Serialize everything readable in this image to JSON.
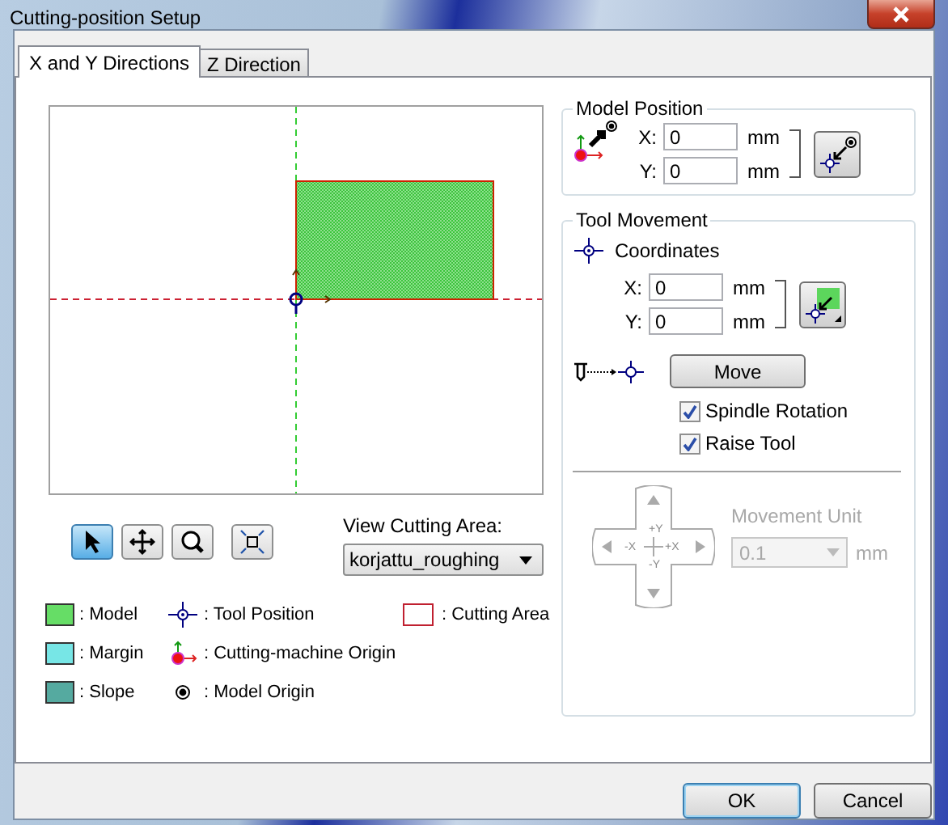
{
  "window": {
    "title": "Cutting-position Setup"
  },
  "tabs": [
    {
      "label": "X and Y Directions",
      "selected": true
    },
    {
      "label": "Z Direction",
      "selected": false
    }
  ],
  "view_tools": [
    {
      "kind": "pointer",
      "selected": true
    },
    {
      "kind": "pan",
      "selected": false
    },
    {
      "kind": "zoom",
      "selected": false
    },
    {
      "kind": "fit",
      "selected": false
    }
  ],
  "view_cutting_area": {
    "label": "View Cutting Area:",
    "value": "korjattu_roughing"
  },
  "legend": [
    [
      {
        "kind": "swatch",
        "color": "#66dd66",
        "label": ": Model"
      },
      {
        "kind": "swatch",
        "color": "#77e6e6",
        "label": ": Margin"
      },
      {
        "kind": "swatch",
        "color": "#55aaa0",
        "label": ": Slope"
      }
    ],
    [
      {
        "kind": "tool",
        "label": ": Tool Position"
      },
      {
        "kind": "machine-origin",
        "label": ": Cutting-machine Origin"
      },
      {
        "kind": "model-origin",
        "label": ": Model Origin"
      }
    ],
    [
      {
        "kind": "area",
        "label": ": Cutting Area"
      }
    ]
  ],
  "model_position": {
    "title": "Model Position",
    "fields": [
      {
        "label": "X:",
        "value": "0",
        "unit": "mm"
      },
      {
        "label": "Y:",
        "value": "0",
        "unit": "mm"
      }
    ]
  },
  "tool_movement": {
    "title": "Tool Movement",
    "coordinates": "Coordinates",
    "fields": [
      {
        "label": "X:",
        "value": "0",
        "unit": "mm"
      },
      {
        "label": "Y:",
        "value": "0",
        "unit": "mm"
      }
    ],
    "move_button": "Move",
    "checkboxes": [
      {
        "label": "Spindle Rotation",
        "checked": true
      },
      {
        "label": "Raise Tool",
        "checked": true
      }
    ],
    "jog_labels": [
      "+Y",
      "-X",
      "+X",
      "-Y"
    ],
    "movement_unit": {
      "label": "Movement Unit",
      "value": "0.1",
      "unit": "mm",
      "disabled": true
    }
  },
  "buttons": [
    {
      "label": "OK",
      "default": true
    },
    {
      "label": "Cancel",
      "default": false
    }
  ]
}
